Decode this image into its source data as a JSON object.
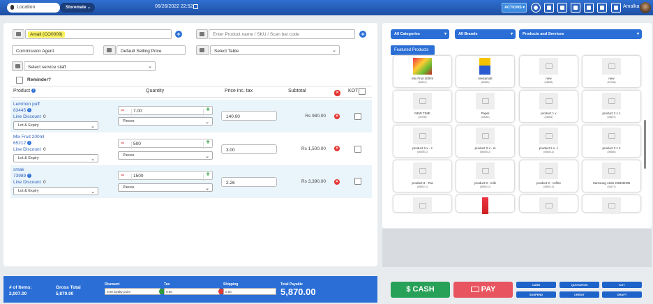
{
  "topbar": {
    "location": "Location",
    "store": "Storemate",
    "datetime": "06/26/2022 22:52",
    "actions": "ACTIONS",
    "user": "Amalka"
  },
  "customer": {
    "name": "Amali (CO0009)"
  },
  "search": {
    "placeholder": "Enter Product name / SKU / Scan bar code"
  },
  "commission": {
    "value": "Commission Agent"
  },
  "price_group": {
    "value": "Default Selling Price"
  },
  "table_select": {
    "value": "Select Table"
  },
  "service_staff": {
    "value": "Select service staff"
  },
  "reminder": {
    "label": "Reminder?"
  },
  "columns": {
    "product": "Product",
    "quantity": "Quantity",
    "price": "Price inc. tax",
    "subtotal": "Subtotal",
    "kot": "KOT"
  },
  "rows": [
    {
      "name": "Lemmon puff",
      "code": "83445",
      "discount_label": "Line Discount",
      "discount": "0",
      "lot": "Lot & Expiry",
      "qty": "7.00",
      "unit": "Pieces",
      "price": "140.00",
      "subtotal": "Rs 980.00"
    },
    {
      "name": "Mix Fruit 200ml",
      "code": "65212",
      "discount_label": "Line Discount",
      "discount": "0",
      "lot": "Lot & Expiry",
      "qty": "500",
      "unit": "Pieces",
      "price": "3.00",
      "subtotal": "Rs 1,500.00"
    },
    {
      "name": "smak",
      "code": "73989",
      "discount_label": "Line Discount",
      "discount": "0",
      "lot": "Lot & Expiry",
      "qty": "1500",
      "unit": "Pieces",
      "price": "2.26",
      "subtotal": "Rs 3,390.00"
    }
  ],
  "filters": {
    "categories": "All Categories",
    "brands": "All Brands",
    "type": "Products and Services",
    "featured": "Featured Products"
  },
  "products": [
    {
      "name": "Mix Fruit 200ml",
      "code": "(65212)"
    },
    {
      "name": "Nestamalt",
      "code": "(65345)"
    },
    {
      "name": "new",
      "code": "(06483)"
    },
    {
      "name": "new",
      "code": "(57048)"
    },
    {
      "name": "NEW TIME",
      "code": "(06798)"
    },
    {
      "name": "Paper",
      "code": "(00084)"
    },
    {
      "name": "product 1 x",
      "code": "(06606)"
    },
    {
      "name": "product 2 x 1",
      "code": "(06607)"
    },
    {
      "name": "product 2 x - s",
      "code": "(06606-1)"
    },
    {
      "name": "product 2 x - m",
      "code": "(06606-2)"
    },
    {
      "name": "product 2 x - l",
      "code": "(06606-3)"
    },
    {
      "name": "product 3 x 2",
      "code": "(06666)"
    },
    {
      "name": "product 8 - Tea",
      "code": "(08802-1)"
    },
    {
      "name": "product 8 - milk",
      "code": "(08802-2)"
    },
    {
      "name": "product 8 - coffee",
      "code": "(08802-3)"
    },
    {
      "name": "Samsung A53s 2GB/32GB",
      "code": "(06127)"
    },
    {
      "name": "",
      "code": ""
    },
    {
      "name": "",
      "code": ""
    },
    {
      "name": "",
      "code": ""
    },
    {
      "name": "",
      "code": ""
    }
  ],
  "totals": {
    "items_label": "# of Items:",
    "items": "2,007.00",
    "gross_label": "Gross Total",
    "gross": "5,870.00",
    "discount_label": "Discount",
    "discount_value": "0.00 loyalty point",
    "tax_label": "Tax",
    "tax_value": "0.00",
    "shipping_label": "Shipping",
    "shipping_value": "0.00",
    "payable_label": "Total Payable",
    "payable": "5,870.00"
  },
  "pay": {
    "cash": "$ CASH",
    "pay": "PAY",
    "card": "CARD",
    "quotation": "QUOTATION",
    "kot": "KOT",
    "suspend": "SUSPEND",
    "credit": "CREDIT",
    "draft": "DRAFT"
  },
  "colors": {
    "primary": "#2b6fd6",
    "cash": "#28a158",
    "pay": "#e8545f",
    "highlight": "#f9f15a"
  }
}
